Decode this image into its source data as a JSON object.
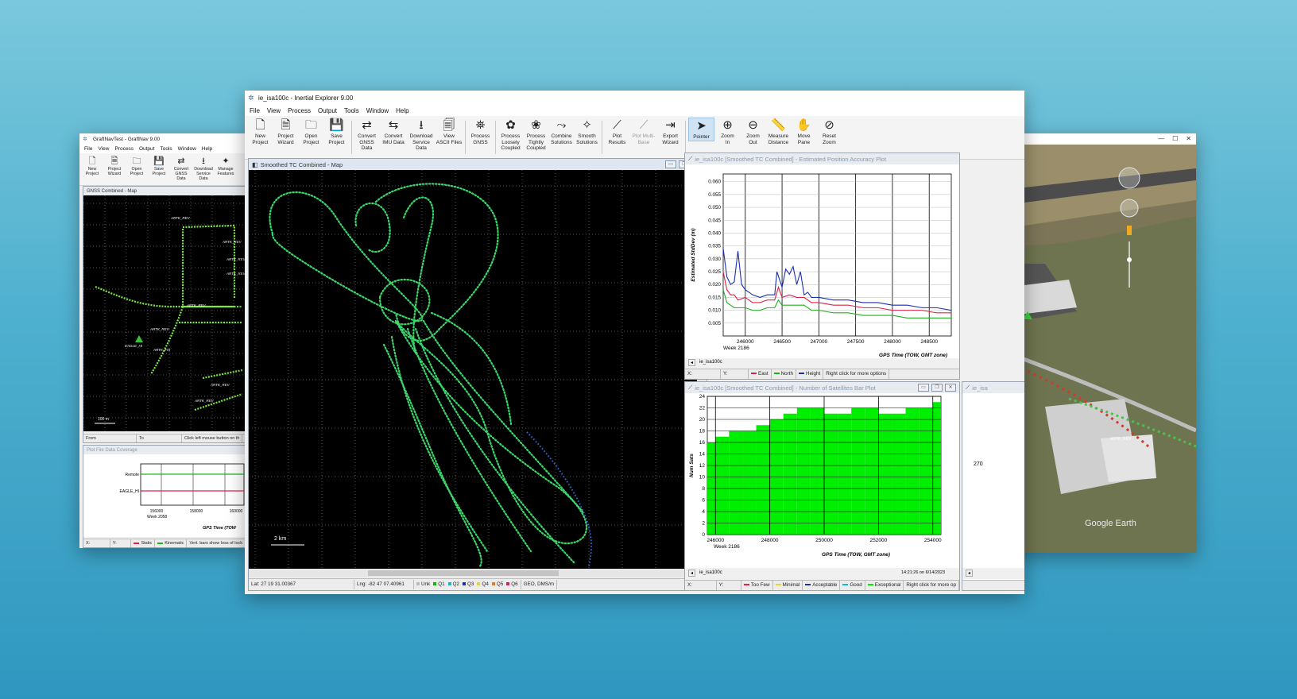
{
  "graftnav": {
    "title": "GraftNavTest - GraftNav 9.00",
    "menu": [
      "File",
      "View",
      "Process",
      "Output",
      "Tools",
      "Window",
      "Help"
    ],
    "toolbar": [
      {
        "icon": "new-project-icon",
        "label": "New\nProject"
      },
      {
        "icon": "project-wizard-icon",
        "label": "Project\nWizard"
      },
      {
        "icon": "open-project-icon",
        "label": "Open\nProject"
      },
      {
        "icon": "save-project-icon",
        "label": "Save\nProject"
      },
      {
        "icon": "convert-gnss-icon",
        "label": "Convert\nGNSS\nData"
      },
      {
        "icon": "download-service-icon",
        "label": "Download\nService\nData"
      },
      {
        "icon": "manage-features-icon",
        "label": "Manage\nFeatures"
      }
    ],
    "map_title": "GNSS Combined - Map",
    "map_labels": [
      "ARTK_REV",
      "ARTK_REV",
      "ARTK_REV",
      "ARTK_REV",
      "ARTK_REV",
      "ARTK_REV",
      "EAGLE_HI",
      "ARTK_FIX",
      "ARTK_REV",
      "ARTK_REV"
    ],
    "scale": "100 m",
    "status": [
      "From",
      "To",
      "Click left mouse button on th"
    ],
    "coverage_title": "Plot File Data Coverage",
    "coverage_rows": [
      "Remote",
      "EAGLE_HI"
    ],
    "coverage_ticks": [
      "156000",
      "158000",
      "160000"
    ],
    "coverage_week": "Week 2058",
    "coverage_xlabel": "GPS Time (TOW",
    "coverage_status": [
      "X:",
      "Y:",
      "Static",
      "Kinematic",
      "Vert. bars show loss of lock"
    ]
  },
  "inertial": {
    "title": "ie_isa100c - Inertial Explorer 9.00",
    "menu": [
      "File",
      "View",
      "Process",
      "Output",
      "Tools",
      "Window",
      "Help"
    ],
    "toolbar": [
      {
        "icon": "new-project-icon",
        "label": "New\nProject"
      },
      {
        "icon": "project-wizard-icon",
        "label": "Project\nWizard"
      },
      {
        "icon": "open-project-icon",
        "label": "Open\nProject"
      },
      {
        "icon": "save-project-icon",
        "label": "Save\nProject"
      },
      {
        "sep": true
      },
      {
        "icon": "convert-gnss-icon",
        "label": "Convert\nGNSS\nData"
      },
      {
        "icon": "convert-imu-icon",
        "label": "Convert\nIMU Data"
      },
      {
        "icon": "download-service-icon",
        "label": "Download\nService\nData"
      },
      {
        "icon": "view-ascii-icon",
        "label": "View\nASCII Files"
      },
      {
        "sep": true
      },
      {
        "icon": "process-gnss-icon",
        "label": "Process\nGNSS"
      },
      {
        "sep": true
      },
      {
        "icon": "process-loosely-icon",
        "label": "Process\nLoosely\nCoupled"
      },
      {
        "icon": "process-tightly-icon",
        "label": "Process\nTightly\nCoupled"
      },
      {
        "icon": "combine-solutions-icon",
        "label": "Combine\nSolutions"
      },
      {
        "icon": "smooth-solutions-icon",
        "label": "Smooth\nSolutions"
      },
      {
        "sep": true
      },
      {
        "icon": "plot-results-icon",
        "label": "Plot\nResults"
      },
      {
        "icon": "plot-multibase-icon",
        "label": "Plot Multi-\nBase",
        "disabled": true
      },
      {
        "icon": "export-wizard-icon",
        "label": "Export\nWizard"
      },
      {
        "sep": true
      },
      {
        "icon": "pointer-icon",
        "label": "Pointer",
        "active": true
      },
      {
        "icon": "zoom-in-icon",
        "label": "Zoom\nIn"
      },
      {
        "icon": "zoom-out-icon",
        "label": "Zoom\nOut"
      },
      {
        "icon": "measure-distance-icon",
        "label": "Measure\nDistance"
      },
      {
        "icon": "move-pane-icon",
        "label": "Move\nPane"
      },
      {
        "icon": "reset-zoom-icon",
        "label": "Reset\nZoom"
      }
    ],
    "map": {
      "title": "Smoothed TC Combined - Map",
      "scale": "2 km",
      "status": [
        "Lat: 27 19 31.00367",
        "Lng: -82 47 07.40961",
        "Unk",
        "Q1",
        "Q2",
        "Q3",
        "Q4",
        "Q5",
        "Q6",
        "GEO, DMS/m"
      ]
    },
    "accuracy": {
      "title": "ie_isa100c [Smoothed TC Combined] - Estimated Position Accuracy Plot",
      "footer_left": "ie_isa100c",
      "xlabel": "GPS Time (TOW, GMT zone)",
      "week": "Week 2186",
      "status": [
        "X:",
        "Y:",
        "East",
        "North",
        "Height",
        "Right click for more options"
      ]
    },
    "sats": {
      "title": "ie_isa100c [Smoothed TC Combined] - Number of Satellites Bar Plot",
      "footer_left": "ie_isa100c",
      "xlabel": "GPS Time (TOW, GMT zone)",
      "week": "Week 2186",
      "timestamp": "14:21:26 on 6/14/2023",
      "status": [
        "X:",
        "Y:",
        "Too Few",
        "Minimal",
        "Acceptable",
        "Good",
        "Exceptional",
        "Right click for more op"
      ]
    },
    "third_pane": {
      "title": "ie_isa",
      "label": "270"
    }
  },
  "earth": {
    "labels": [
      "EAGLE_HI",
      "ARTK_REV"
    ],
    "watermark": "Google Earth"
  },
  "colors": {
    "east": "#e0204a",
    "north": "#20b020",
    "height": "#1a2fb0",
    "track": "#3cd66a",
    "bars": "#00ee00"
  },
  "chart_data": [
    {
      "type": "line",
      "title": "ie_isa100c [Smoothed TC Combined] - Estimated Position Accuracy Plot",
      "xlabel": "GPS Time (TOW, GMT zone)",
      "ylabel": "Estimated StdDev (m)",
      "xlim": [
        245700,
        248800
      ],
      "ylim": [
        0.0,
        0.063
      ],
      "x_ticks": [
        246000,
        246500,
        247000,
        247500,
        248000,
        248500
      ],
      "y_ticks": [
        0.005,
        0.01,
        0.015,
        0.02,
        0.025,
        0.03,
        0.035,
        0.04,
        0.045,
        0.05,
        0.055,
        0.06
      ],
      "grid": true,
      "series": [
        {
          "name": "East",
          "x": [
            245700,
            245750,
            245800,
            245850,
            245900,
            246000,
            246100,
            246200,
            246300,
            246400,
            246450,
            246500,
            246600,
            246700,
            246800,
            246900,
            247000,
            247200,
            247400,
            247600,
            247800,
            248000,
            248200,
            248400,
            248600,
            248800
          ],
          "y": [
            0.025,
            0.018,
            0.016,
            0.016,
            0.014,
            0.015,
            0.013,
            0.013,
            0.014,
            0.014,
            0.019,
            0.015,
            0.016,
            0.015,
            0.015,
            0.013,
            0.013,
            0.012,
            0.012,
            0.011,
            0.011,
            0.01,
            0.01,
            0.01,
            0.009,
            0.009
          ]
        },
        {
          "name": "North",
          "x": [
            245700,
            245750,
            245800,
            245850,
            245900,
            246000,
            246100,
            246200,
            246300,
            246400,
            246450,
            246500,
            246600,
            246700,
            246800,
            246900,
            247000,
            247200,
            247400,
            247600,
            247800,
            248000,
            248200,
            248400,
            248600,
            248800
          ],
          "y": [
            0.018,
            0.013,
            0.012,
            0.011,
            0.011,
            0.011,
            0.01,
            0.01,
            0.011,
            0.011,
            0.014,
            0.012,
            0.012,
            0.012,
            0.012,
            0.01,
            0.01,
            0.009,
            0.009,
            0.008,
            0.008,
            0.008,
            0.007,
            0.007,
            0.007,
            0.007
          ]
        },
        {
          "name": "Height",
          "x": [
            245700,
            245750,
            245800,
            245850,
            245900,
            245950,
            246000,
            246100,
            246200,
            246300,
            246400,
            246430,
            246500,
            246550,
            246600,
            246650,
            246700,
            246750,
            246800,
            246850,
            246900,
            247000,
            247200,
            247400,
            247600,
            247800,
            248000,
            248200,
            248400,
            248600,
            248800
          ],
          "y": [
            0.034,
            0.023,
            0.02,
            0.021,
            0.033,
            0.02,
            0.018,
            0.016,
            0.015,
            0.016,
            0.016,
            0.025,
            0.019,
            0.026,
            0.024,
            0.027,
            0.02,
            0.025,
            0.016,
            0.017,
            0.015,
            0.015,
            0.014,
            0.014,
            0.013,
            0.013,
            0.012,
            0.012,
            0.011,
            0.011,
            0.01
          ]
        }
      ]
    },
    {
      "type": "bar",
      "title": "ie_isa100c [Smoothed TC Combined] - Number of Satellites Bar Plot",
      "xlabel": "GPS Time (TOW, GMT zone)",
      "ylabel": "Num Sats",
      "xlim": [
        245700,
        254300
      ],
      "ylim": [
        0,
        24
      ],
      "x_ticks": [
        246000,
        248000,
        250000,
        252000,
        254000
      ],
      "y_ticks": [
        0,
        2,
        4,
        6,
        8,
        10,
        12,
        14,
        16,
        18,
        20,
        22,
        24
      ],
      "grid": true,
      "series": [
        {
          "name": "Num Sats",
          "x": [
            245700,
            246000,
            246500,
            247000,
            247500,
            248000,
            248500,
            249000,
            249500,
            250000,
            250500,
            251000,
            251500,
            252000,
            252500,
            253000,
            253500,
            254000,
            254300
          ],
          "y": [
            16,
            17,
            18,
            18,
            19,
            20,
            21,
            22,
            22,
            21,
            21,
            22,
            22,
            21,
            21,
            22,
            22,
            23,
            22
          ]
        }
      ]
    }
  ]
}
